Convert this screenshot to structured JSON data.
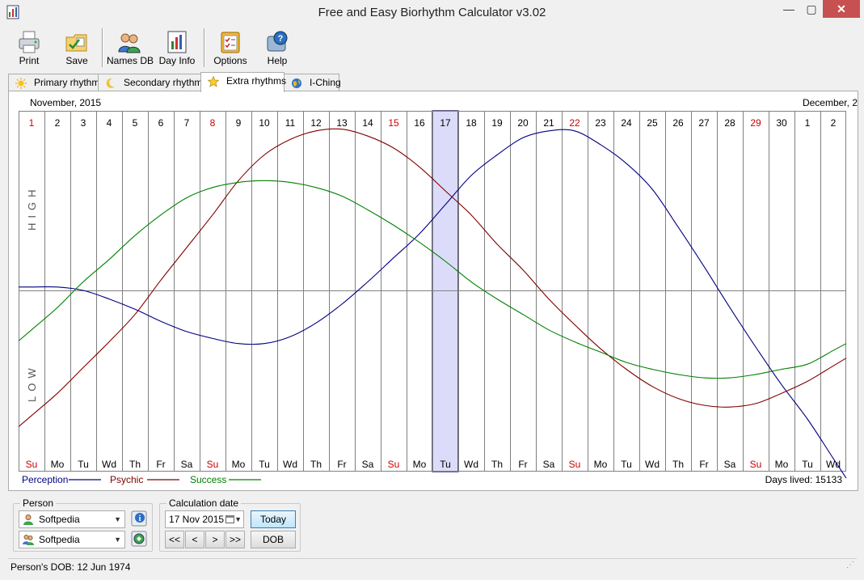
{
  "window": {
    "title": "Free and Easy Biorhythm Calculator v3.02",
    "minimize": "—",
    "maximize": "▢",
    "close": "✕"
  },
  "toolbar": [
    {
      "label": "Print",
      "icon": "printer-icon"
    },
    {
      "label": "Save",
      "icon": "folder-save-icon"
    },
    {
      "label": "Names DB",
      "icon": "people-icon"
    },
    {
      "label": "Day Info",
      "icon": "day-info-chart-icon"
    },
    {
      "label": "Options",
      "icon": "checklist-icon"
    },
    {
      "label": "Help",
      "icon": "help-icon"
    }
  ],
  "tabs": [
    {
      "label": "Primary rhythms",
      "icon": "sun-icon"
    },
    {
      "label": "Secondary rhythms",
      "icon": "moon-icon"
    },
    {
      "label": "Extra rhythms",
      "icon": "star-icon",
      "active": true
    },
    {
      "label": "I-Ching",
      "icon": "globe-icon"
    }
  ],
  "chart_data": {
    "type": "line",
    "month_left": "November, 2015",
    "month_right": "December, 2",
    "days": [
      "1",
      "2",
      "3",
      "4",
      "5",
      "6",
      "7",
      "8",
      "9",
      "10",
      "11",
      "12",
      "13",
      "14",
      "15",
      "16",
      "17",
      "18",
      "19",
      "20",
      "21",
      "22",
      "23",
      "24",
      "25",
      "26",
      "27",
      "28",
      "29",
      "30",
      "1",
      "2"
    ],
    "weekdays": [
      "Su",
      "Mo",
      "Tu",
      "Wd",
      "Th",
      "Fr",
      "Sa",
      "Su",
      "Mo",
      "Tu",
      "Wd",
      "Th",
      "Fr",
      "Sa",
      "Su",
      "Mo",
      "Tu",
      "Wd",
      "Th",
      "Fr",
      "Sa",
      "Su",
      "Mo",
      "Tu",
      "Wd",
      "Th",
      "Fr",
      "Sa",
      "Su",
      "Mo",
      "Tu",
      "Wd"
    ],
    "sundays": [
      0,
      7,
      14,
      21,
      28
    ],
    "selected_day_index": 16,
    "high_label": "HIGH",
    "low_label": "LOW",
    "ylim": [
      -1,
      1
    ],
    "series": [
      {
        "name": "Perception",
        "color": "#000080",
        "values": [
          0.02,
          0.02,
          0.0,
          -0.05,
          -0.11,
          -0.18,
          -0.24,
          -0.28,
          -0.31,
          -0.31,
          -0.27,
          -0.19,
          -0.08,
          0.05,
          0.19,
          0.33,
          0.5,
          0.67,
          0.79,
          0.89,
          0.93,
          0.93,
          0.85,
          0.74,
          0.59,
          0.37,
          0.14,
          -0.1,
          -0.33,
          -0.55,
          -0.75,
          -0.98
        ]
      },
      {
        "name": "Psychic",
        "color": "#800000",
        "values": [
          -0.73,
          -0.6,
          -0.45,
          -0.3,
          -0.14,
          0.06,
          0.25,
          0.44,
          0.64,
          0.79,
          0.88,
          0.93,
          0.94,
          0.9,
          0.83,
          0.72,
          0.58,
          0.44,
          0.27,
          0.12,
          -0.05,
          -0.2,
          -0.34,
          -0.46,
          -0.56,
          -0.63,
          -0.67,
          -0.68,
          -0.66,
          -0.6,
          -0.53,
          -0.44
        ]
      },
      {
        "name": "Success",
        "color": "#008000",
        "values": [
          -0.23,
          -0.1,
          0.05,
          0.18,
          0.32,
          0.44,
          0.54,
          0.6,
          0.63,
          0.64,
          0.63,
          0.6,
          0.55,
          0.47,
          0.38,
          0.28,
          0.17,
          0.05,
          -0.05,
          -0.14,
          -0.23,
          -0.3,
          -0.36,
          -0.42,
          -0.46,
          -0.49,
          -0.51,
          -0.51,
          -0.49,
          -0.46,
          -0.43,
          -0.35
        ]
      }
    ]
  },
  "legend": [
    {
      "name": "Perception",
      "color": "#000080"
    },
    {
      "name": "Psychic",
      "color": "#800000"
    },
    {
      "name": "Success",
      "color": "#008000"
    }
  ],
  "days_lived": "Days lived: 15133",
  "person": {
    "group_label": "Person",
    "primary": "Softpedia",
    "secondary": "Softpedia"
  },
  "calc": {
    "group_label": "Calculation date",
    "date": "17 Nov 2015",
    "today": "Today",
    "dob": "DOB",
    "nav": [
      "<<",
      "<",
      ">",
      ">>"
    ]
  },
  "status": {
    "dob_text": "Person's DOB: 12 Jun 1974"
  }
}
